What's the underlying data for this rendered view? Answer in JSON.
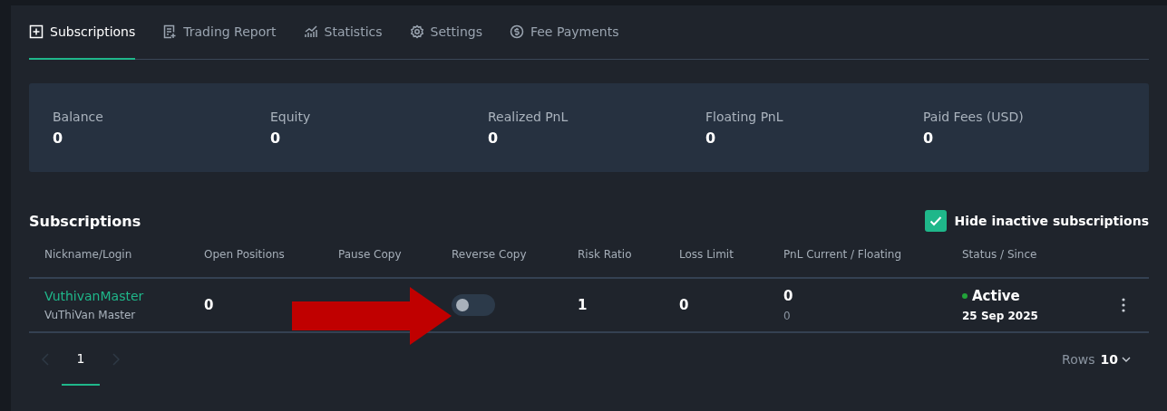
{
  "tabs": [
    {
      "label": "Subscriptions",
      "kind": "plus",
      "selected": true
    },
    {
      "label": "Trading Report",
      "kind": "report",
      "selected": false
    },
    {
      "label": "Statistics",
      "kind": "chart",
      "selected": false
    },
    {
      "label": "Settings",
      "kind": "gear",
      "selected": false
    },
    {
      "label": "Fee Payments",
      "kind": "coin",
      "selected": false
    }
  ],
  "summary": [
    {
      "label": "Balance",
      "value": "0"
    },
    {
      "label": "Equity",
      "value": "0"
    },
    {
      "label": "Realized PnL",
      "value": "0"
    },
    {
      "label": "Floating PnL",
      "value": "0"
    },
    {
      "label": "Paid Fees (USD)",
      "value": "0"
    }
  ],
  "subscriptions": {
    "title": "Subscriptions",
    "hide_inactive": {
      "label": "Hide inactive subscriptions",
      "checked": true
    },
    "columns": [
      "Nickname/Login",
      "Open Positions",
      "Pause Copy",
      "Reverse Copy",
      "Risk Ratio",
      "Loss Limit",
      "PnL Current / Floating",
      "Status / Since"
    ],
    "rows": [
      {
        "nickname": "VuthivanMaster",
        "login": "VuThiVan Master",
        "open_positions": "0",
        "reverse_copy": false,
        "risk_ratio": "1",
        "loss_limit": "0",
        "pnl_current": "0",
        "pnl_floating": "0",
        "status": {
          "label": "Active",
          "color": "#22a33a"
        },
        "since": "25 Sep 2025"
      }
    ],
    "pages": [
      {
        "label": "1",
        "selected": true
      }
    ],
    "rows_label": "Rows",
    "rows_value": "10"
  },
  "annotation": {
    "kind": "arrow"
  }
}
